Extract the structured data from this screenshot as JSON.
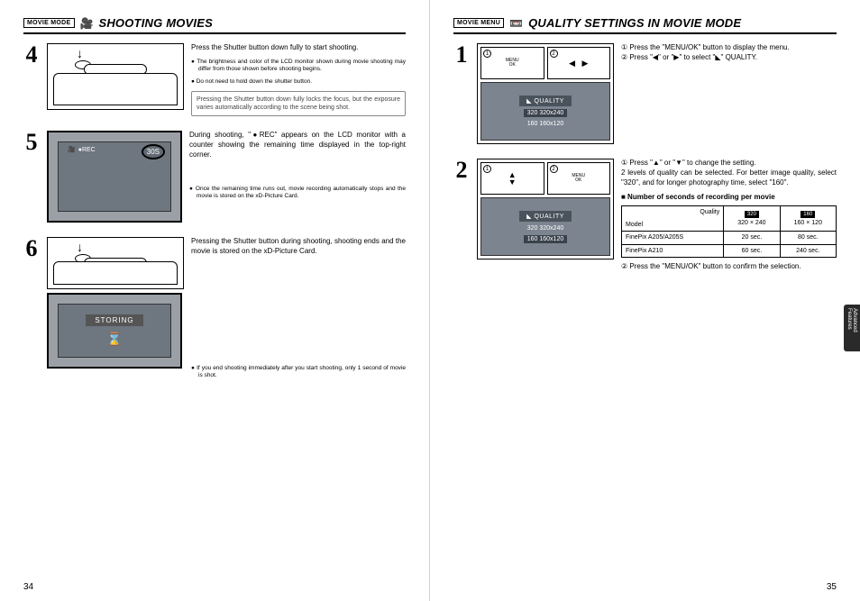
{
  "left": {
    "mode_tag": "MOVIE MODE",
    "icon": "🎥",
    "title": "SHOOTING MOVIES",
    "page_number": "34",
    "steps": [
      {
        "num": "4",
        "text": "Press the Shutter button down fully to start shooting.",
        "notes": [
          "● The brightness and color of the LCD monitor shown during movie shooting may differ from those shown before shooting begins.",
          "● Do not need to hold down the shutter button."
        ],
        "callout": "Pressing the Shutter button down fully locks the focus, but the exposure varies automatically according to the scene being shot."
      },
      {
        "num": "5",
        "rec_label": "●REC",
        "rec_time": "30S",
        "text": "During shooting, \"●REC\" appears on the LCD monitor with a counter showing the remaining time displayed in the top-right corner.",
        "notes": [
          "● Once the remaining time runs out, movie recording automatically stops and the movie is stored on the xD-Picture Card."
        ]
      },
      {
        "num": "6",
        "storing": "STORING",
        "text": "Pressing the Shutter button during shooting, shooting ends and the movie is stored on the xD-Picture Card.",
        "notes": [
          "● If you end shooting immediately after you start shooting, only 1 second of movie is shot."
        ]
      }
    ]
  },
  "right": {
    "mode_tag": "MOVIE MENU",
    "icon": "📼",
    "title": "QUALITY SETTINGS IN MOVIE MODE",
    "page_number": "35",
    "side_tab": "Advanced Features",
    "steps": [
      {
        "num": "1",
        "menu_ok": "MENU\nOK",
        "quality_label": "◣ QUALITY",
        "opt1": "320 320x240",
        "opt2": "160 160x120",
        "lines": [
          "① Press the \"MENU/OK\" button to display the menu.",
          "② Press \"◀\" or \"▶\" to select \"◣\" QUALITY."
        ]
      },
      {
        "num": "2",
        "menu_ok": "MENU\nOK",
        "quality_label": "◣ QUALITY",
        "opt1": "320 320x240",
        "opt2": "160 160x120",
        "lines": [
          "① Press \"▲\" or \"▼\" to change the setting.",
          "2 levels of quality can be selected. For better image quality, select \"320\", and for longer photography time, select \"160\"."
        ],
        "confirm": "② Press the \"MENU/OK\" button to confirm the selection."
      }
    ],
    "table": {
      "caption": "■ Number of seconds of recording per movie",
      "head_quality": "Quality",
      "head_model": "Model",
      "col1": "320 × 240",
      "col2": "160 × 120",
      "col1_icon": "320",
      "col2_icon": "160",
      "rows": [
        {
          "model": "FinePix A205/A205S",
          "c1": "20 sec.",
          "c2": "80 sec."
        },
        {
          "model": "FinePix A210",
          "c1": "60 sec.",
          "c2": "240 sec."
        }
      ]
    }
  }
}
